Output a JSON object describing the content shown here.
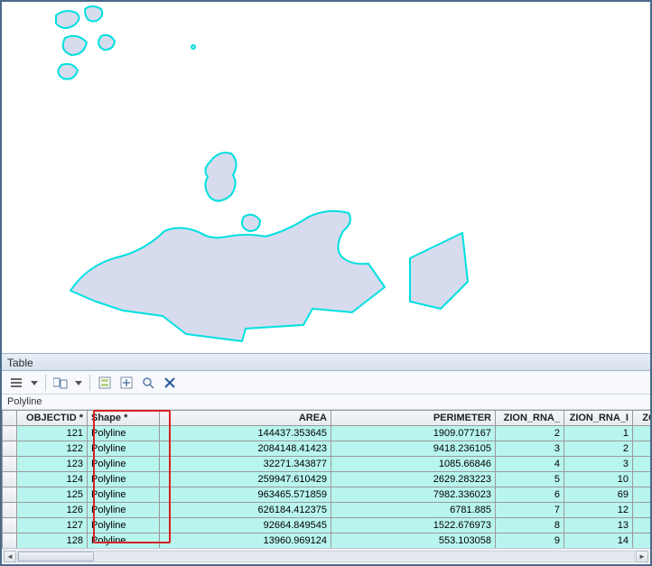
{
  "panel": {
    "title": "Table"
  },
  "layer": {
    "name": "Polyline"
  },
  "table": {
    "columns": {
      "objectid": "OBJECTID *",
      "shape": "Shape *",
      "area": "AREA",
      "perimeter": "PERIMETER",
      "zion_rna": "ZION_RNA_",
      "zion_rna_i": "ZION_RNA_I",
      "zoi": "ZOI"
    },
    "rows": [
      {
        "objectid": "121",
        "shape": "Polyline",
        "area": "144437.353645",
        "perimeter": "1909.077167",
        "zion_rna": "2",
        "zion_rna_i": "1"
      },
      {
        "objectid": "122",
        "shape": "Polyline",
        "area": "2084148.41423",
        "perimeter": "9418.236105",
        "zion_rna": "3",
        "zion_rna_i": "2"
      },
      {
        "objectid": "123",
        "shape": "Polyline",
        "area": "32271.343877",
        "perimeter": "1085.66846",
        "zion_rna": "4",
        "zion_rna_i": "3"
      },
      {
        "objectid": "124",
        "shape": "Polyline",
        "area": "259947.610429",
        "perimeter": "2629.283223",
        "zion_rna": "5",
        "zion_rna_i": "10"
      },
      {
        "objectid": "125",
        "shape": "Polyline",
        "area": "963465.571859",
        "perimeter": "7982.336023",
        "zion_rna": "6",
        "zion_rna_i": "69"
      },
      {
        "objectid": "126",
        "shape": "Polyline",
        "area": "626184.412375",
        "perimeter": "6781.885",
        "zion_rna": "7",
        "zion_rna_i": "12"
      },
      {
        "objectid": "127",
        "shape": "Polyline",
        "area": "92664.849545",
        "perimeter": "1522.676973",
        "zion_rna": "8",
        "zion_rna_i": "13"
      },
      {
        "objectid": "128",
        "shape": "Polyline",
        "area": "13960.969124",
        "perimeter": "553.103058",
        "zion_rna": "9",
        "zion_rna_i": "14"
      }
    ]
  },
  "icons": {
    "menu": "menu-icon",
    "dropdown": "chevron-down-icon",
    "related": "related-tables-icon",
    "export": "export-icon",
    "select": "select-by-attr-icon",
    "zoom": "zoom-selection-icon",
    "clear": "clear-selection-icon"
  }
}
